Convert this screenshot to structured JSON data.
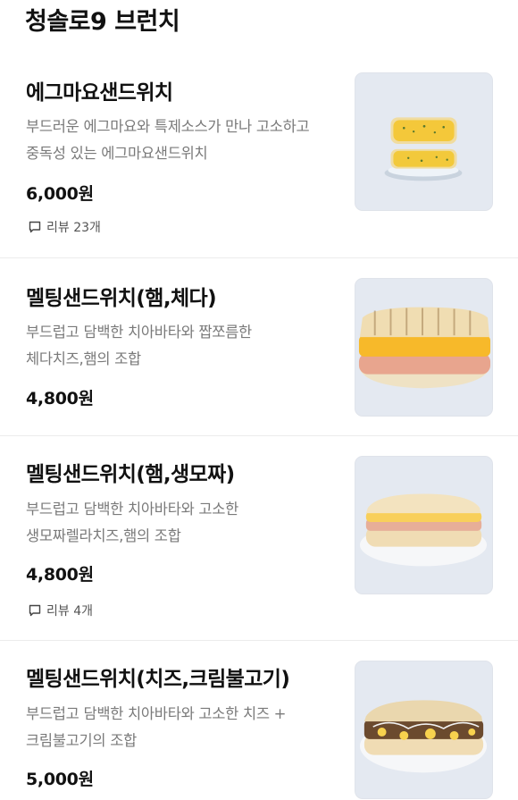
{
  "section": {
    "title": "청솔로9 브런치"
  },
  "items": [
    {
      "name": "에그마요샌드위치",
      "desc_lines": [
        "부드러운 에그마요와 특제소스가 만나 고소하고",
        "중독성 있는 에그마요샌드위치"
      ],
      "price": "6,000원",
      "review": "리뷰 23개",
      "photo_icon": "egg-mayo-sandwich-photo"
    },
    {
      "name": "멜팅샌드위치(햄,체다)",
      "desc_lines": [
        "부드럽고 담백한 치아바타와 짭쪼름한",
        "체다치즈,햄의 조합"
      ],
      "price": "4,800원",
      "review": "",
      "photo_icon": "ham-cheddar-panini-photo"
    },
    {
      "name": "멜팅샌드위치(햄,생모짜)",
      "desc_lines": [
        "부드럽고 담백한 치아바타와 고소한",
        "생모짜렐라치즈,햄의 조합"
      ],
      "price": "4,800원",
      "review": "리뷰 4개",
      "photo_icon": "ham-mozzarella-panini-photo"
    },
    {
      "name": "멜팅샌드위치(치즈,크림불고기)",
      "desc_lines": [
        "부드럽고 담백한 치아바타와 고소한 치즈 +",
        "크림불고기의 조합"
      ],
      "price": "5,000원",
      "review": "",
      "photo_icon": "cheese-bulgogi-panini-photo"
    }
  ],
  "colors": {
    "title": "#111111",
    "description": "#7a7a7a",
    "photo_background": "#e3e8f0",
    "divider": "#ececec"
  }
}
